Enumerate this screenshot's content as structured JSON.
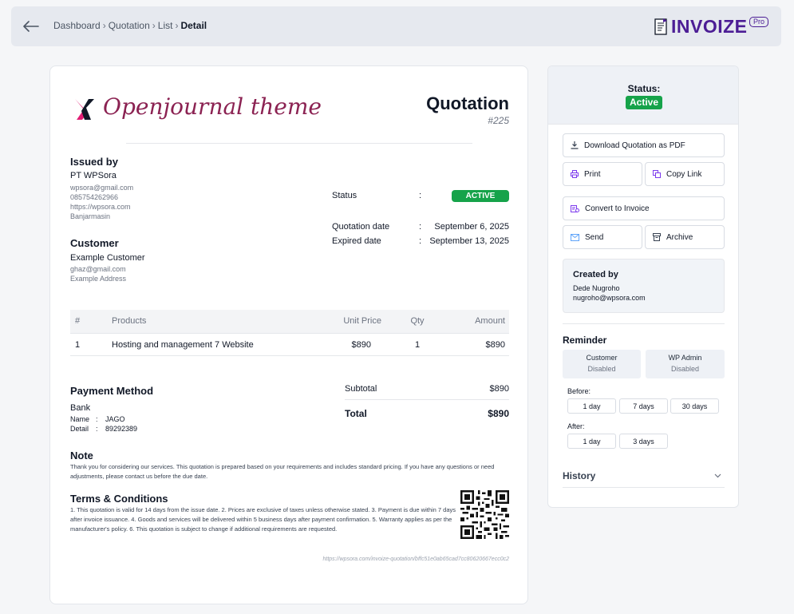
{
  "breadcrumb": {
    "items": [
      "Dashboard",
      "Quotation",
      "List"
    ],
    "current": "Detail"
  },
  "brand": {
    "name": "INVOIZE",
    "badge": "Pro"
  },
  "company": {
    "logo_text": "Openjournal theme"
  },
  "quotation": {
    "title": "Quotation",
    "number": "#225",
    "status_label": "Status",
    "status": "ACTIVE",
    "date_label": "Quotation date",
    "date": "September 6, 2025",
    "expired_label": "Expired date",
    "expired": "September 13, 2025",
    "colon": ":"
  },
  "issued_by": {
    "heading": "Issued by",
    "name": "PT WPSora",
    "email": "wpsora@gmail.com",
    "phone": "085754262966",
    "website": "https://wpsora.com",
    "city": "Banjarmasin"
  },
  "customer": {
    "heading": "Customer",
    "name": "Example Customer",
    "email": "ghaz@gmail.com",
    "address": "Example Address"
  },
  "table": {
    "headers": [
      "#",
      "Products",
      "Unit Price",
      "Qty",
      "Amount"
    ],
    "rows": [
      [
        "1",
        "Hosting and management 7 Website",
        "$890",
        "1",
        "$890"
      ]
    ]
  },
  "payment": {
    "heading": "Payment Method",
    "method": "Bank",
    "name_label": "Name",
    "name": "JAGO",
    "detail_label": "Detail",
    "detail": "89292389",
    "colon": ":"
  },
  "totals": {
    "subtotal_label": "Subtotal",
    "subtotal": "$890",
    "total_label": "Total",
    "total": "$890"
  },
  "note": {
    "heading": "Note",
    "text": "Thank you for considering our services. This quotation is prepared based on your requirements and includes standard pricing. If you have any questions or need adjustments, please contact us before the due date."
  },
  "terms": {
    "heading": "Terms & Conditions",
    "text": "1. This quotation is valid for 14 days from the issue date. 2. Prices are exclusive of taxes unless otherwise stated. 3. Payment is due within 7 days after invoice issuance. 4. Goods and services will be delivered within 5 business days after payment confirmation. 5. Warranty applies as per the manufacturer's policy. 6. This quotation is subject to change if additional requirements are requested."
  },
  "footer_url": "https://wpsora.com/invoize-quotation/bffc51e0ab65cad7cc80620667ecc0c2",
  "sidebar": {
    "status_label": "Status:",
    "status": "Active",
    "download_label": "Download Quotation as PDF",
    "print_label": "Print",
    "copy_label": "Copy Link",
    "convert_label": "Convert to Invoice",
    "send_label": "Send",
    "archive_label": "Archive",
    "created_heading": "Created by",
    "created_name": "Dede Nugroho",
    "created_email": "nugroho@wpsora.com",
    "reminder_heading": "Reminder",
    "reminder_customer": "Customer",
    "reminder_customer_state": "Disabled",
    "reminder_admin": "WP Admin",
    "reminder_admin_state": "Disabled",
    "before_label": "Before:",
    "before_options": [
      "1 day",
      "7 days",
      "30 days"
    ],
    "after_label": "After:",
    "after_options": [
      "1 day",
      "3 days"
    ],
    "history_label": "History"
  },
  "colors": {
    "accent": "#4c1d95",
    "active": "#16a34a",
    "logo": "#8b2252"
  }
}
